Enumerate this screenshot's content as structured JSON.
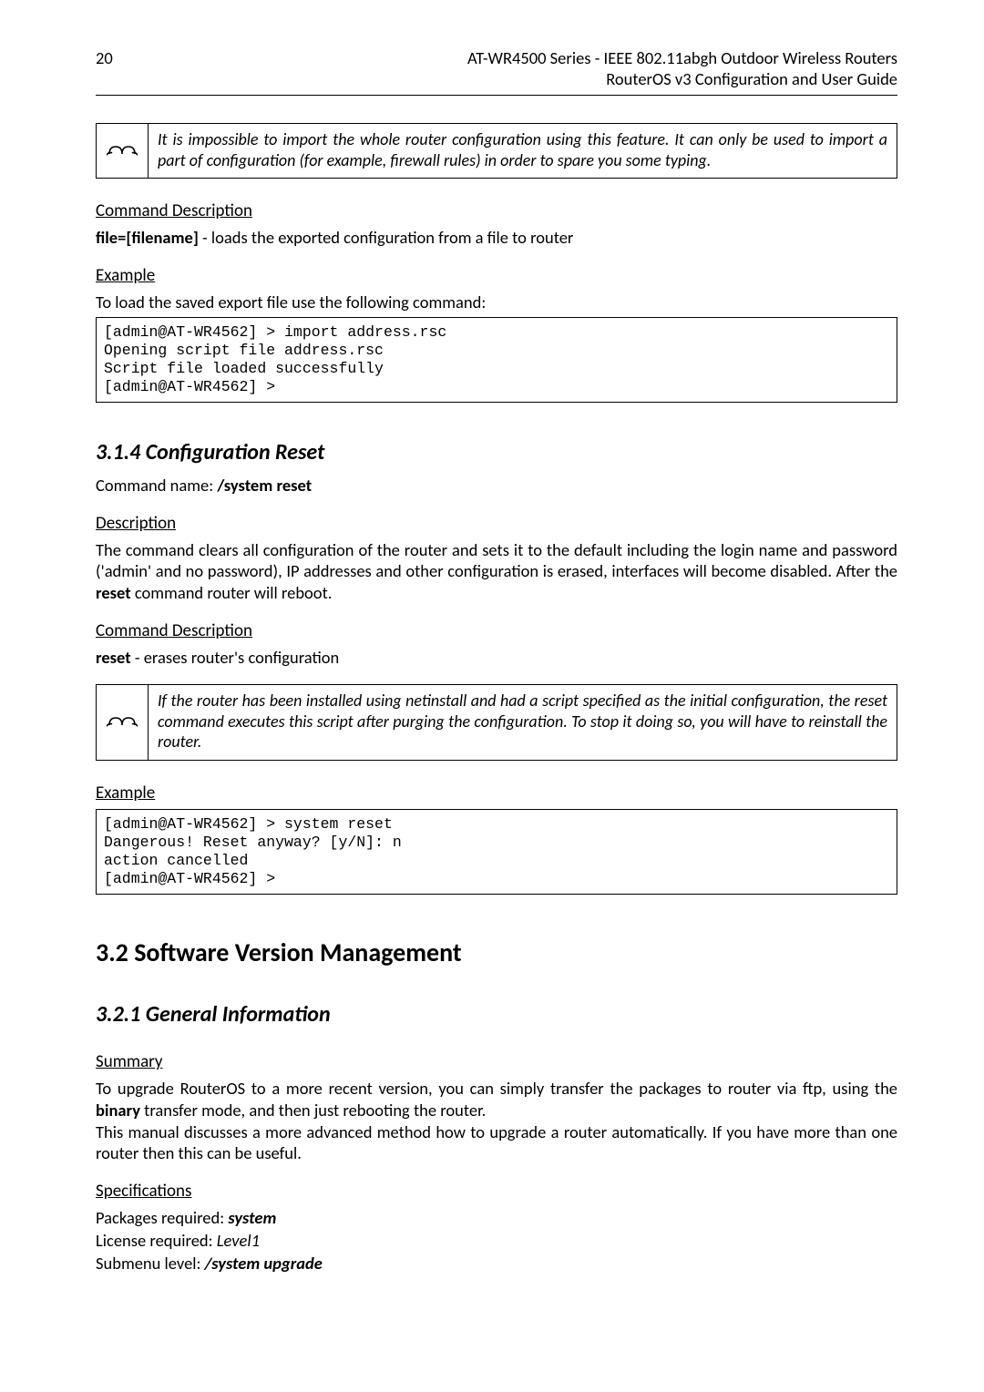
{
  "header": {
    "page_number": "20",
    "title_line1": "AT-WR4500 Series - IEEE 802.11abgh Outdoor Wireless Routers",
    "title_line2": "RouterOS v3 Configuration and User Guide"
  },
  "note1": "It is impossible to import the whole router configuration using this feature. It can only be used to import a part of configuration (for example, firewall rules) in order to spare you some typing.",
  "cmd_desc_heading": "Command Description",
  "cmd_desc_file_label": "file=[filename]",
  "cmd_desc_file_text": " - loads the exported configuration from a file to router",
  "example_heading": "Example",
  "example_intro": "To load the saved export file use the following command:",
  "code1": "[admin@AT-WR4562] > import address.rsc\nOpening script file address.rsc\nScript file loaded successfully\n[admin@AT-WR4562] >",
  "s314": {
    "heading": "3.1.4  Configuration Reset",
    "cmd_name_label": "Command name: ",
    "cmd_name_value": "/system reset",
    "desc_heading": "Description",
    "desc_text_1": "The command clears all configuration of the router and sets it to the default including the login name and password ('admin' and no password), IP addresses and other configuration is erased, interfaces will become disabled. After the ",
    "desc_reset": "reset",
    "desc_text_2": " command router will reboot.",
    "cmd_desc_heading": "Command Description",
    "cmd_desc_label": "reset",
    "cmd_desc_text": " - erases router's configuration",
    "note2": "If the router has been installed using netinstall and had a script specified as the initial configuration, the reset command executes this script after purging the configuration. To stop it doing so, you will have to reinstall the router.",
    "example_heading": "Example",
    "code2": "[admin@AT-WR4562] > system reset\nDangerous! Reset anyway? [y/N]: n\naction cancelled\n[admin@AT-WR4562] >"
  },
  "s32": {
    "heading": "3.2  Software Version Management"
  },
  "s321": {
    "heading": "3.2.1  General Information",
    "summary_heading": "Summary",
    "summary_p1a": "To upgrade RouterOS to a more recent version, you can simply transfer the packages to router via ftp, using the ",
    "summary_binary": "binary",
    "summary_p1b": " transfer mode, and then just rebooting the router.",
    "summary_p2": "This manual discusses a more advanced method how to upgrade a router automatically. If you have more than one router then this can be useful.",
    "spec_heading": "Specifications",
    "spec_pkg_label": "Packages required: ",
    "spec_pkg_value": "system",
    "spec_lic_label": "License required: ",
    "spec_lic_value": "Level1",
    "spec_sub_label": "Submenu level: ",
    "spec_sub_value": "/system upgrade"
  }
}
